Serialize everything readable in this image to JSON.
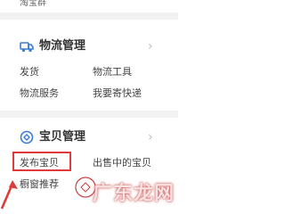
{
  "top": {
    "label": "淘宝群"
  },
  "logistics": {
    "title": "物流管理",
    "items": [
      "发货",
      "物流工具",
      "物流服务",
      "我要寄快递"
    ]
  },
  "items_section": {
    "title": "宝贝管理",
    "items": [
      "发布宝贝",
      "出售中的宝贝",
      "橱窗推荐"
    ]
  },
  "watermark": {
    "text": "广东龙网"
  },
  "colors": {
    "accent": "#3a7bd5",
    "highlight": "#e03a3a"
  }
}
